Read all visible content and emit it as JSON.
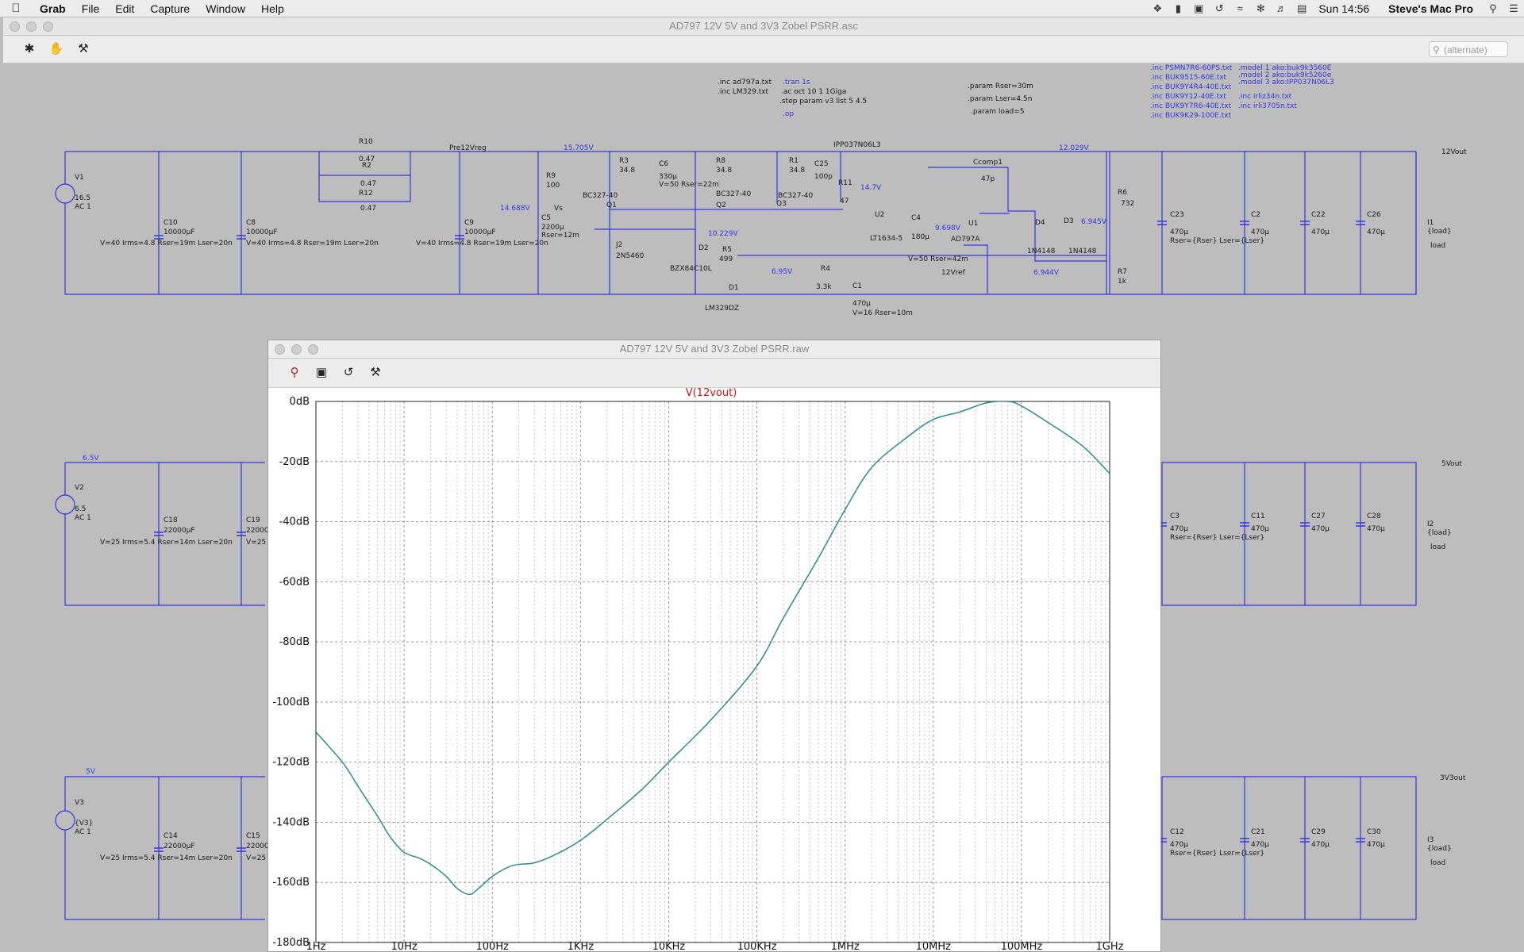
{
  "menubar": {
    "items": [
      "Grab",
      "File",
      "Edit",
      "Capture",
      "Window",
      "Help"
    ],
    "clock": "Sun 14:56",
    "user": "Steve's Mac Pro"
  },
  "schematic_window": {
    "title": "AD797 12V 5V and 3V3 Zobel PSRR.asc",
    "search_placeholder": "(alternate)",
    "directives": {
      "inc1": ".inc ad797a.txt",
      "inc2": ".inc LM329.txt",
      "tran": ".tran 1s",
      "ac": ".ac oct 10 1 1Giga",
      "step": ".step param v3 list 5 4.5",
      "op": ".op",
      "param1": ".param Rser=30m",
      "param2": ".param Lser=4.5n",
      "param3": ".param load=5",
      "incs_a": [
        ".inc PSMN7R6-60PS.txt",
        ".inc BUK9515-60E.txt",
        ".inc BUK9Y4R4-40E.txt",
        ".inc BUK9Y12-40E.txt",
        ".inc BUK9Y7R6-40E.txt",
        ".inc BUK9K29-100E.txt"
      ],
      "models": [
        ".model 1 ako:buk9k3560E",
        ".model 2 ako:buk9k5260e",
        ".model 3 ako:IPP037N06L3"
      ],
      "incs_b": [
        ".inc irliz34n.txt",
        ".inc irli3705n.txt"
      ]
    },
    "labels": {
      "V1": "V1",
      "V1_val": "16.5",
      "V1_ac": "AC 1",
      "C10": "C10",
      "C10_val": "10000µF",
      "C10_spec": "V=40 Irms=4.8 Rser=19m Lser=20n",
      "C8": "C8",
      "C8_val": "10000µF",
      "C8_spec": "V=40 Irms=4.8 Rser=19m Lser=20n",
      "C9": "C9",
      "C9_val": "10000µF",
      "C9_spec": "V=40 Irms=4.8 Rser=19m Lser=20n",
      "R10": "R10",
      "R2": "R2",
      "R12": "R12",
      "R_047": "0.47",
      "Pre12Vreg": "Pre12Vreg",
      "n15705": "15.705V",
      "n14688": "14.688V",
      "Vs": "Vs",
      "R9": "R9",
      "R9_val": "100",
      "C5": "C5",
      "C5_val": "2200µ",
      "C5_spec": "Rser=12m",
      "R3": "R3",
      "R3_val": "34.8",
      "C6": "C6",
      "C6_val": "330µ",
      "C6_spec": "V=50 Rser=22m",
      "R8": "R8",
      "R8_val": "34.8",
      "R1": "R1",
      "R1_val": "34.8",
      "C25": "C25",
      "C25_val": "100p",
      "Q1": "Q1",
      "Q2": "Q2",
      "Q3": "Q3",
      "BC327": "BC327-40",
      "J2": "J2",
      "J2_val": "2N5460",
      "IPP": "IPP037N06L3",
      "R11": "R11",
      "R11_val": "47",
      "U2": "U2",
      "U2_val": "LT1634-5",
      "n14v": "14.7V",
      "C4": "C4",
      "C4_val": "180µ",
      "C4_spec": "V=50 Rser=42m",
      "n9698": "9.698V",
      "Ccomp1": "Ccomp1",
      "Ccomp1_val": "47p",
      "U1": "U1",
      "U1_val": "AD797A",
      "D4": "D4",
      "D3": "D3",
      "D1N4148": "1N4148",
      "n12029": "12.029V",
      "n6945": "6.945V",
      "R6": "R6",
      "R6_val": "732",
      "R7": "R7",
      "R7_val": "1k",
      "n10229": "10.229V",
      "D2": "D2",
      "D2_val": "BZX84C10L",
      "R5": "R5",
      "R5_val": "499",
      "D1": "D1",
      "D1_val": "LM329DZ",
      "n695": "6.95V",
      "R4": "R4",
      "R4_val": "3.3k",
      "C1": "C1",
      "C1_val": "470µ",
      "C1_spec": "V=16 Rser=10m",
      "V12ref": "12Vref",
      "n6944": "6.944V",
      "C23": "C23",
      "C2": "C2",
      "C22": "C22",
      "C26": "C26",
      "C470": "470µ",
      "Rser_Lser": "Rser={Rser} Lser={Lser}",
      "I1": "I1",
      "load_val": "{load}",
      "load": "load",
      "out12": "12Vout",
      "n65": "6.5V",
      "V2": "V2",
      "V2_val": "6.5",
      "C18": "C18",
      "C19": "C19",
      "C22000": "22000µF",
      "C18_spec": "V=25 Irms=5.4 Rser=14m Lser=20n",
      "C19_part": "V=25 I",
      "C3": "C3",
      "C11": "C11",
      "C27": "C27",
      "C28": "C28",
      "I2": "I2",
      "out5": "5Vout",
      "n5": "5V",
      "V3": "V3",
      "V3_val": "{V3}",
      "C14": "C14",
      "C15": "C15",
      "C12": "C12",
      "C21": "C21",
      "C29": "C29",
      "C30": "C30",
      "I3": "I3",
      "out33": "3V3out"
    }
  },
  "plot_window": {
    "title": "AD797 12V 5V and 3V3 Zobel PSRR.raw",
    "trace_label": "V(12vout)"
  },
  "chart_data": {
    "type": "line",
    "title": "",
    "trace_name": "V(12vout)",
    "x_scale": "log",
    "xlim": [
      1,
      1000000000
    ],
    "ylim": [
      -180,
      0
    ],
    "x_ticks": [
      1,
      10,
      100,
      1000,
      10000,
      100000,
      1000000,
      10000000,
      100000000,
      1000000000
    ],
    "x_tick_labels": [
      "1Hz",
      "10Hz",
      "100Hz",
      "1KHz",
      "10KHz",
      "100KHz",
      "1MHz",
      "10MHz",
      "100MHz",
      "1GHz"
    ],
    "y_ticks": [
      0,
      -20,
      -40,
      -60,
      -80,
      -100,
      -120,
      -140,
      -160,
      -180
    ],
    "y_tick_labels": [
      "0dB",
      "-20dB",
      "-40dB",
      "-60dB",
      "-80dB",
      "-100dB",
      "-120dB",
      "-140dB",
      "-160dB",
      "-180dB"
    ],
    "grid": true,
    "trace_color": "#2e8b8b",
    "series": [
      {
        "name": "V(12vout)",
        "x": [
          1,
          2,
          3,
          5,
          7,
          10,
          15,
          20,
          30,
          40,
          55,
          70,
          100,
          150,
          200,
          300,
          500,
          1000,
          2000,
          5000,
          10000,
          30000,
          100000,
          200000,
          500000,
          1000000,
          2000000,
          5000000,
          10000000,
          20000000,
          40000000,
          70000000,
          100000000,
          200000000,
          500000000,
          1000000000
        ],
        "y": [
          -110,
          -120,
          -128,
          -138,
          -145,
          -150,
          -152,
          -154,
          -158,
          -162,
          -164,
          -162,
          -158,
          -155,
          -154,
          -153.5,
          -151,
          -146,
          -139,
          -129,
          -120,
          -106,
          -88,
          -72,
          -52,
          -36,
          -22,
          -12,
          -6,
          -3.5,
          -0.5,
          0,
          -1.5,
          -7,
          -15,
          -24
        ]
      }
    ]
  }
}
